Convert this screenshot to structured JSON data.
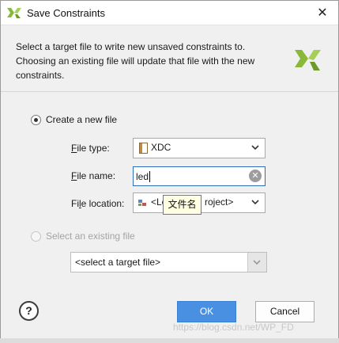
{
  "window": {
    "title": "Save Constraints",
    "close_glyph": "✕"
  },
  "description": "Select a target file to write new unsaved constraints to. Choosing an existing file will update that file with the new constraints.",
  "create_new": {
    "radio_label": "Create a new file",
    "file_type": {
      "label_u": "F",
      "label_rest": "ile type:",
      "value": "XDC",
      "icon": "xdc-file-icon"
    },
    "file_name": {
      "label_u": "F",
      "label_rest": "ile name:",
      "value": "led",
      "clear_icon": "clear-icon"
    },
    "file_location": {
      "label_pre": "Fi",
      "label_u": "l",
      "label_rest": "e location:",
      "value_left": "<Lo",
      "value_right": "roject>",
      "icon": "project-folder-icon"
    }
  },
  "tooltip": "文件名",
  "select_existing": {
    "radio_label": "Select an existing file",
    "placeholder": "<select a target file>"
  },
  "buttons": {
    "help": "?",
    "ok": "OK",
    "cancel": "Cancel"
  },
  "watermark": "https://blog.csdn.net/WP_FD",
  "colors": {
    "accent": "#4a90e2",
    "brand_green": "#8ab83a"
  }
}
